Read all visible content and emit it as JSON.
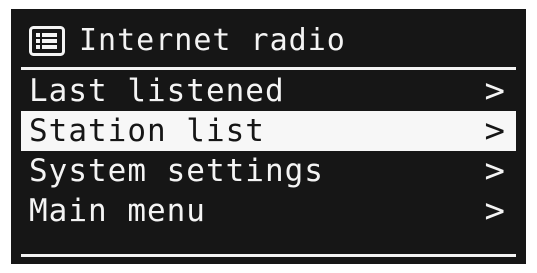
{
  "screen": {
    "title": "Internet radio",
    "title_icon": "list-icon",
    "colors": {
      "background": "#161616",
      "foreground": "#f4f4f4",
      "highlight_background": "#f7f7f7",
      "highlight_text": "#161616"
    }
  },
  "menu": {
    "items": [
      {
        "label": "Last listened",
        "arrow": ">"
      },
      {
        "label": "Station list",
        "arrow": ">",
        "selected": true
      },
      {
        "label": "System settings",
        "arrow": ">"
      },
      {
        "label": "Main menu",
        "arrow": ">"
      }
    ]
  }
}
